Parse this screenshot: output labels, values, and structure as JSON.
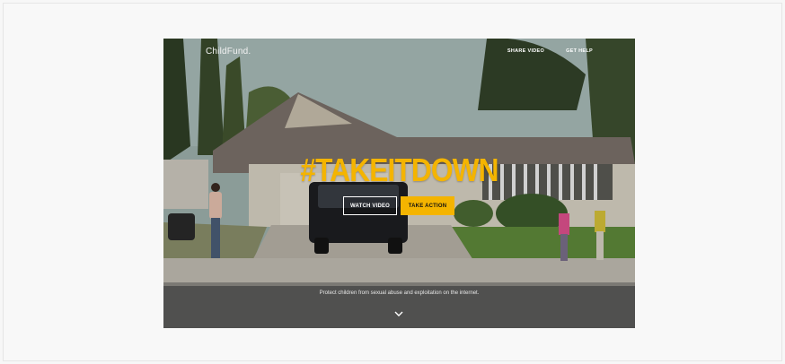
{
  "brand": {
    "logo_text": "ChildFund."
  },
  "nav": {
    "share_video": "SHARE VIDEO",
    "get_help": "GET HELP"
  },
  "hero": {
    "headline": "#TAKEITDOWN",
    "watch_label": "WATCH VIDEO",
    "action_label": "TAKE ACTION",
    "tagline": "Protect children from sexual abuse and exploitation on the internet.",
    "scroll_icon": "chevron-down-icon"
  },
  "colors": {
    "accent": "#f4b400",
    "text_light": "#ffffff",
    "page_bg": "#f7f7f7"
  }
}
